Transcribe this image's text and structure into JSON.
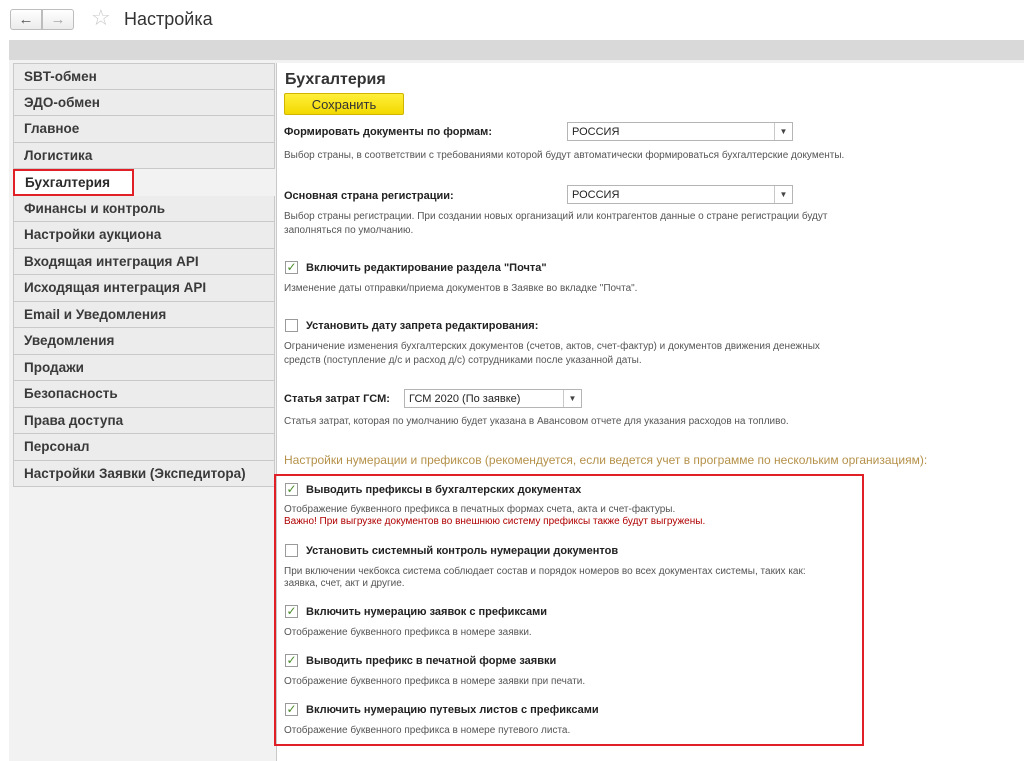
{
  "toolbar": {
    "back_label": "←",
    "forward_label": "→",
    "favorite_glyph": "☆",
    "title": "Настройка"
  },
  "sidebar": {
    "items": [
      {
        "label": "SBT-обмен"
      },
      {
        "label": "ЭДО-обмен"
      },
      {
        "label": "Главное"
      },
      {
        "label": "Логистика"
      },
      {
        "label": "Бухгалтерия",
        "active": true
      },
      {
        "label": "Финансы и контроль"
      },
      {
        "label": "Настройки аукциона"
      },
      {
        "label": "Входящая интеграция API"
      },
      {
        "label": "Исходящая интеграция API"
      },
      {
        "label": "Email и Уведомления"
      },
      {
        "label": "Уведомления"
      },
      {
        "label": "Продажи"
      },
      {
        "label": "Безопасность"
      },
      {
        "label": "Права доступа"
      },
      {
        "label": "Персонал"
      },
      {
        "label": "Настройки Заявки (Экспедитора)"
      }
    ]
  },
  "main": {
    "title": "Бухгалтерия",
    "save_label": "Сохранить",
    "form_docs": {
      "label": "Формировать документы по формам:",
      "value": "РОССИЯ",
      "hint": "Выбор страны, в соответствии с требованиями которой будут автоматически формироваться бухгалтерские документы."
    },
    "reg_country": {
      "label": "Основная страна регистрации:",
      "value": "РОССИЯ",
      "hint1": "Выбор страны регистрации. При создании новых организаций или контрагентов данные о стране регистрации будут",
      "hint2": "заполняться по умолчанию."
    },
    "mail_edit": {
      "label": "Включить редактирование раздела \"Почта\"",
      "checked": true,
      "hint": "Изменение даты отправки/приема документов в Заявке во вкладке \"Почта\"."
    },
    "edit_ban": {
      "label": "Установить дату запрета редактирования:",
      "checked": false,
      "hint1": "Ограничение изменения бухгалтерских документов (счетов, актов, счет-фактур) и документов движения денежных",
      "hint2": "средств (поступление д/с и расход д/с) сотрудниками после указанной даты."
    },
    "fuel": {
      "label": "Статья затрат ГСМ:",
      "value": "ГСМ 2020 (По заявке)",
      "hint": "Статья затрат, которая по умолчанию будет указана в Авансовом отчете для указания расходов на топливо."
    },
    "numbering": {
      "title": "Настройки нумерации и префиксов (рекомендуется, если ведется учет в программе по нескольким организациям):",
      "prefix_docs": {
        "label": "Выводить префиксы в бухгалтерских документах",
        "checked": true,
        "hint": "Отображение буквенного префикса в печатных формах счета, акта и счет-фактуры.",
        "warning": "Важно! При выгрузке документов во внешнюю систему префиксы также будут выгружены."
      },
      "sys_control": {
        "label": "Установить системный контроль нумерации документов",
        "checked": false,
        "hint1": "При включении чекбокса система соблюдает состав и порядок номеров во всех документах системы, таких как:",
        "hint2": "заявка, счет, акт и другие."
      },
      "req_prefix": {
        "label": "Включить нумерацию заявок с префиксами",
        "checked": true,
        "hint": "Отображение буквенного префикса в номере заявки."
      },
      "print_prefix": {
        "label": "Выводить префикс в печатной форме заявки",
        "checked": true,
        "hint": "Отображение буквенного префикса в номере заявки при печати."
      },
      "waybill_prefix": {
        "label": "Включить нумерацию путевых листов с префиксами",
        "checked": true,
        "hint": "Отображение буквенного префикса в номере путевого листа."
      }
    }
  },
  "colors": {
    "accent_red": "#e01f26",
    "save_yellow": "#f7e21a",
    "section_gold": "#b5914a",
    "check_green": "#4a8a2a",
    "warning_red": "#b00000"
  }
}
